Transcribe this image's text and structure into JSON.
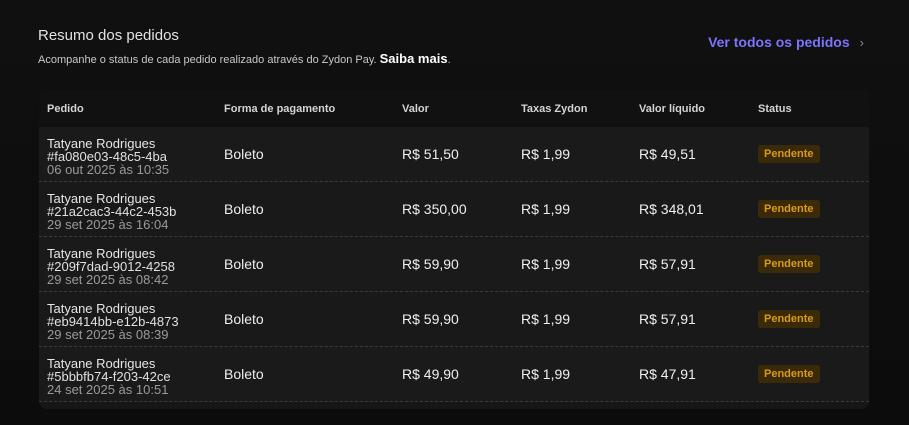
{
  "header": {
    "title": "Resumo dos pedidos",
    "subtitle": "Acompanhe o status de cada pedido realizado através do Zydon Pay.",
    "learn_more": "Saiba mais",
    "view_all": "Ver todos os pedidos",
    "view_all_icon": "chevron-right-icon"
  },
  "columns": [
    "Pedido",
    "Forma de pagamento",
    "Valor",
    "Taxas Zydon",
    "Valor líquido",
    "Status"
  ],
  "rows": [
    {
      "name": "Tatyane Rodrigues",
      "id": "#fa080e03-48c5-4ba",
      "date": "06 out 2025 às 10:35",
      "method": "Boleto",
      "value": "R$ 51,50",
      "fee": "R$ 1,99",
      "net": "R$ 49,51",
      "status": "Pendente"
    },
    {
      "name": "Tatyane Rodrigues",
      "id": "#21a2cac3-44c2-453b",
      "date": "29 set 2025 às 16:04",
      "method": "Boleto",
      "value": "R$ 350,00",
      "fee": "R$ 1,99",
      "net": "R$ 348,01",
      "status": "Pendente"
    },
    {
      "name": "Tatyane Rodrigues",
      "id": "#209f7dad-9012-4258",
      "date": "29 set 2025 às 08:42",
      "method": "Boleto",
      "value": "R$ 59,90",
      "fee": "R$ 1,99",
      "net": "R$ 57,91",
      "status": "Pendente"
    },
    {
      "name": "Tatyane Rodrigues",
      "id": "#eb9414bb-e12b-4873",
      "date": "29 set 2025 às 08:39",
      "method": "Boleto",
      "value": "R$ 59,90",
      "fee": "R$ 1,99",
      "net": "R$ 57,91",
      "status": "Pendente"
    },
    {
      "name": "Tatyane Rodrigues",
      "id": "#5bbbfb74-f203-42ce",
      "date": "24 set 2025 às 10:51",
      "method": "Boleto",
      "value": "R$ 49,90",
      "fee": "R$ 1,99",
      "net": "R$ 47,91",
      "status": "Pendente"
    }
  ],
  "colors": {
    "accent": "#7c74ff",
    "badge_bg": "#3a2a08",
    "badge_text": "#d89a1e"
  }
}
